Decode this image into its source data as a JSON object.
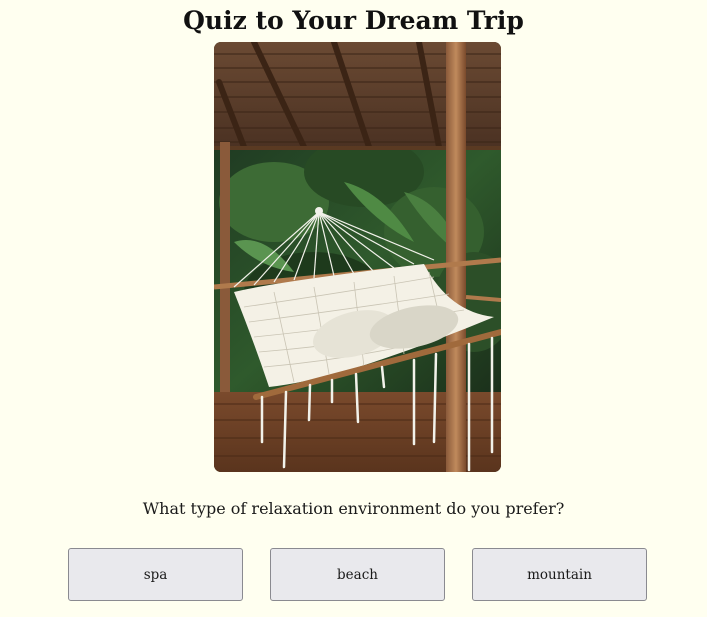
{
  "quiz": {
    "title": "Quiz to Your Dream Trip",
    "question": "What type of relaxation environment do you prefer?",
    "options": [
      {
        "label": "spa"
      },
      {
        "label": "beach"
      },
      {
        "label": "mountain"
      }
    ]
  },
  "photo": {
    "subject": "hammock-under-thatched-roof"
  }
}
